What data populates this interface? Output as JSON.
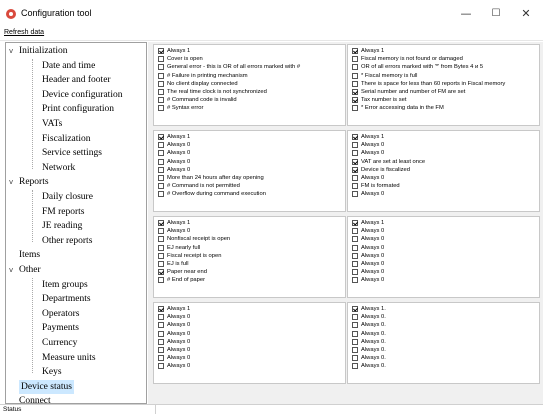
{
  "window": {
    "title": "Configuration tool",
    "minimize_glyph": "—",
    "maximize_glyph": "☐",
    "close_glyph": "✕"
  },
  "menu": {
    "refresh_label": "Refresh data"
  },
  "tree": {
    "items": [
      {
        "label": "Initialization",
        "toggle": "v"
      },
      {
        "label": "Date and time"
      },
      {
        "label": "Header and footer"
      },
      {
        "label": "Device configuration"
      },
      {
        "label": "Print configuration"
      },
      {
        "label": "VATs"
      },
      {
        "label": "Fiscalization"
      },
      {
        "label": "Service settings"
      },
      {
        "label": "Network"
      },
      {
        "label": "Reports",
        "toggle": "v"
      },
      {
        "label": "Daily closure"
      },
      {
        "label": "FM reports"
      },
      {
        "label": "JE reading"
      },
      {
        "label": "Other reports"
      },
      {
        "label": "Items"
      },
      {
        "label": "Other",
        "toggle": "v"
      },
      {
        "label": "Item groups"
      },
      {
        "label": "Departments"
      },
      {
        "label": "Operators"
      },
      {
        "label": "Payments"
      },
      {
        "label": "Currency"
      },
      {
        "label": "Measure units"
      },
      {
        "label": "Keys"
      },
      {
        "label": "Device status",
        "selected": true
      },
      {
        "label": "Connect"
      }
    ]
  },
  "panels": [
    {
      "items": [
        {
          "label": "Always 1",
          "checked": true
        },
        {
          "label": "Cover is open",
          "checked": false
        },
        {
          "label": "General error - this is OR of all errors marked with #",
          "checked": false
        },
        {
          "label": "# Failure in printing mechanism",
          "checked": false
        },
        {
          "label": "No client display connected",
          "checked": false
        },
        {
          "label": "The real time clock is not synchronized",
          "checked": false
        },
        {
          "label": "# Command code is invalid",
          "checked": false
        },
        {
          "label": "# Syntax error",
          "checked": false
        }
      ]
    },
    {
      "items": [
        {
          "label": "Always 1",
          "checked": true
        },
        {
          "label": "Fiscal memory is not found or damaged",
          "checked": false
        },
        {
          "label": "OR of all errors marked with '*' from Bytes 4 и 5",
          "checked": false
        },
        {
          "label": "* Fiscal memory is full",
          "checked": false
        },
        {
          "label": "There is space for less than 60 reports in Fiscal memory",
          "checked": false
        },
        {
          "label": "Serial number and number of FM are set",
          "checked": true
        },
        {
          "label": "Tax number is set",
          "checked": true
        },
        {
          "label": "* Error accessing data in the FM",
          "checked": false
        }
      ]
    },
    {
      "items": [
        {
          "label": "Always 1",
          "checked": true
        },
        {
          "label": "Always 0",
          "checked": false
        },
        {
          "label": "Always 0",
          "checked": false
        },
        {
          "label": "Always 0",
          "checked": false
        },
        {
          "label": "Always 0",
          "checked": false
        },
        {
          "label": "More than 24 hours after day opening",
          "checked": false
        },
        {
          "label": "# Command is not permitted",
          "checked": false
        },
        {
          "label": "# Overflow during command execution",
          "checked": false
        }
      ]
    },
    {
      "items": [
        {
          "label": "Always 1",
          "checked": true
        },
        {
          "label": "Always 0",
          "checked": false
        },
        {
          "label": "Always 0",
          "checked": false
        },
        {
          "label": "VAT are set at least once",
          "checked": true
        },
        {
          "label": "Device is fiscalized",
          "checked": true
        },
        {
          "label": "Always 0",
          "checked": false
        },
        {
          "label": "FM is formated",
          "checked": false
        },
        {
          "label": "Always 0",
          "checked": false
        }
      ]
    },
    {
      "items": [
        {
          "label": "Always 1",
          "checked": true
        },
        {
          "label": "Always 0",
          "checked": false
        },
        {
          "label": "Nonfiscal receipt is open",
          "checked": false
        },
        {
          "label": "EJ nearly full",
          "checked": false
        },
        {
          "label": "Fiscal receipt is open",
          "checked": false
        },
        {
          "label": "EJ is full",
          "checked": false
        },
        {
          "label": "Paper near end",
          "checked": true
        },
        {
          "label": "# End of paper",
          "checked": false
        }
      ]
    },
    {
      "items": [
        {
          "label": "Always 1",
          "checked": true
        },
        {
          "label": "Always 0",
          "checked": false
        },
        {
          "label": "Always 0",
          "checked": false
        },
        {
          "label": "Always 0",
          "checked": false
        },
        {
          "label": "Always 0",
          "checked": false
        },
        {
          "label": "Always 0",
          "checked": false
        },
        {
          "label": "Always 0",
          "checked": false
        },
        {
          "label": "Always 0",
          "checked": false
        }
      ]
    },
    {
      "items": [
        {
          "label": "Always 1",
          "checked": true
        },
        {
          "label": "Always 0",
          "checked": false
        },
        {
          "label": "Always 0",
          "checked": false
        },
        {
          "label": "Always 0",
          "checked": false
        },
        {
          "label": "Always 0",
          "checked": false
        },
        {
          "label": "Always 0",
          "checked": false
        },
        {
          "label": "Always 0",
          "checked": false
        },
        {
          "label": "Always 0",
          "checked": false
        }
      ]
    },
    {
      "items": [
        {
          "label": "Always 1.",
          "checked": true
        },
        {
          "label": "Always 0.",
          "checked": false
        },
        {
          "label": "Always 0.",
          "checked": false
        },
        {
          "label": "Always 0.",
          "checked": false
        },
        {
          "label": "Always 0.",
          "checked": false
        },
        {
          "label": "Always 0.",
          "checked": false
        },
        {
          "label": "Always 0.",
          "checked": false
        },
        {
          "label": "Always 0.",
          "checked": false
        }
      ]
    }
  ],
  "status": {
    "text": "Status"
  },
  "colors": {
    "accent": "#cce8ff",
    "app_icon": "#d94a3d"
  }
}
